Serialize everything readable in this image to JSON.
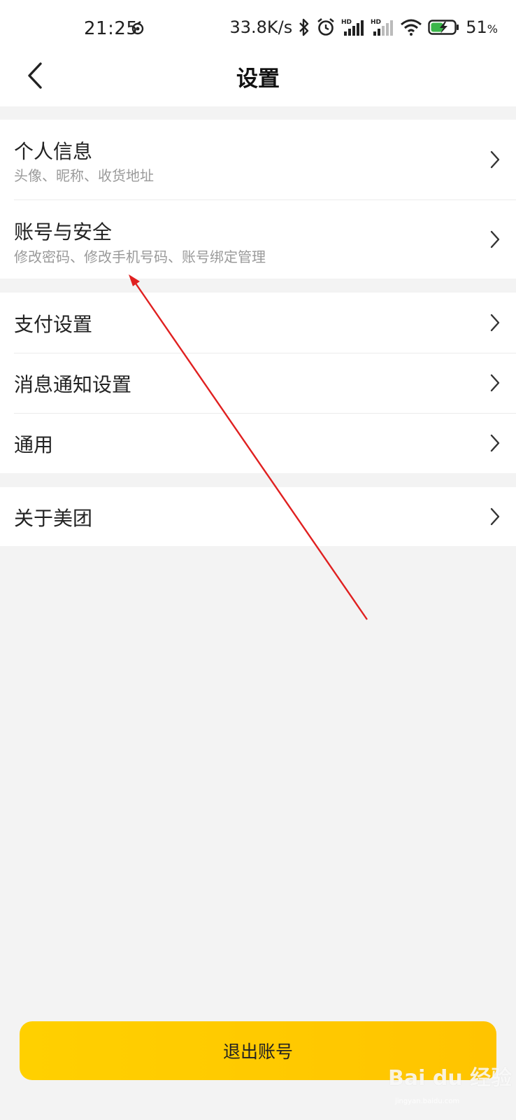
{
  "status_bar": {
    "time": "21:25",
    "network_speed": "33.8K/s",
    "battery": "51",
    "battery_unit": "%",
    "icons": [
      "sync-icon",
      "bluetooth-icon",
      "alarm-icon",
      "signal-hd-icon",
      "signal-hd-icon",
      "wifi-icon",
      "battery-charging-icon"
    ]
  },
  "header": {
    "title": "设置",
    "back_icon": "chevron-left-icon"
  },
  "groups": {
    "account": {
      "items": [
        {
          "title": "个人信息",
          "subtitle": "头像、昵称、收货地址"
        },
        {
          "title": "账号与安全",
          "subtitle": "修改密码、修改手机号码、账号绑定管理"
        }
      ]
    },
    "settings": {
      "items": [
        {
          "title": "支付设置"
        },
        {
          "title": "消息通知设置"
        },
        {
          "title": "通用"
        }
      ]
    },
    "about": {
      "items": [
        {
          "title": "关于美团"
        }
      ]
    }
  },
  "logout": {
    "label": "退出账号"
  },
  "watermark": {
    "text": "Bai du 经验",
    "sub": "jingyan.baidu.com"
  },
  "colors": {
    "accent": "#ffc800",
    "background": "#f3f3f3",
    "annotation_arrow": "#e02020"
  }
}
